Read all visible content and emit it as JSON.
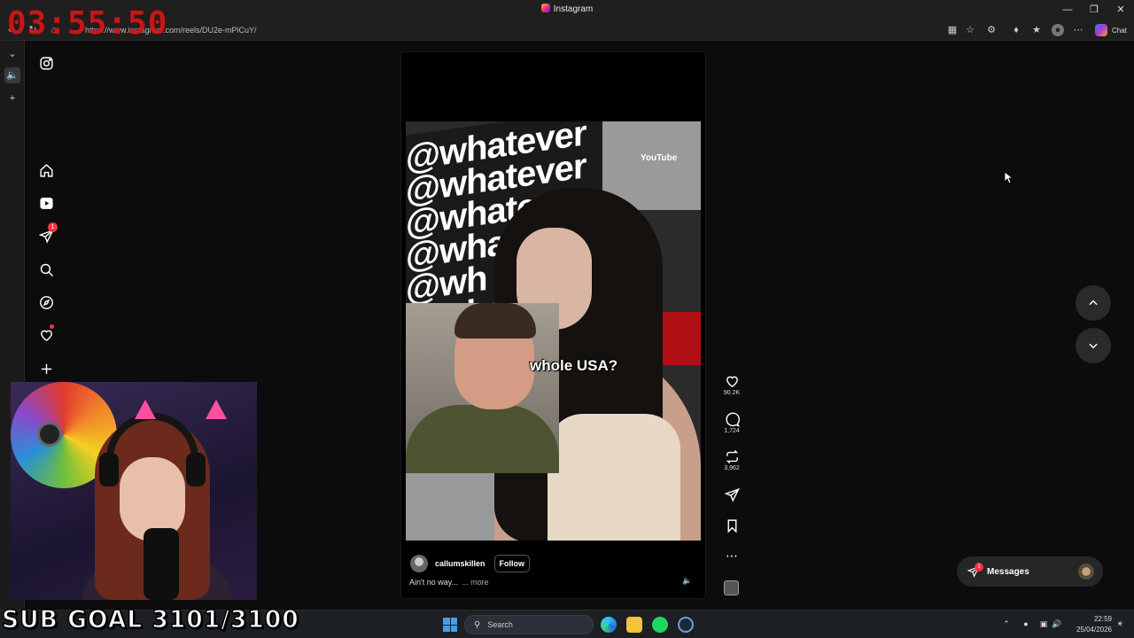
{
  "window": {
    "title": "Instagram"
  },
  "browser": {
    "url": "https://www.instagram.com/reels/DU2e-mPiCuY/",
    "copilot_label": "Chat"
  },
  "overlay": {
    "timer": "03:55:50",
    "sub_goal": "SUB GOAL 3101/3100"
  },
  "sidebar": {
    "items": [
      {
        "name": "home"
      },
      {
        "name": "reels"
      },
      {
        "name": "messages",
        "badge": "1"
      },
      {
        "name": "search"
      },
      {
        "name": "explore"
      },
      {
        "name": "notifications"
      },
      {
        "name": "create"
      }
    ]
  },
  "reel": {
    "overlay_caption": "whole USA?",
    "wall_text": "@whatever @whatever @whatever @whate @wh @whatever",
    "sign_text": "YouTube",
    "author": "callumskillen",
    "follow_label": "Follow",
    "caption": "Ain't no way...",
    "more_label": "... more",
    "likes": "90.2K",
    "comments": "1,724",
    "reposts": "3,962"
  },
  "messages": {
    "label": "Messages",
    "badge": "1"
  },
  "taskbar": {
    "search_placeholder": "Search",
    "time": "22:59",
    "date": "25/04/2026"
  },
  "colors": {
    "accent_red": "#ff3040",
    "timer_red": "#d01818"
  }
}
